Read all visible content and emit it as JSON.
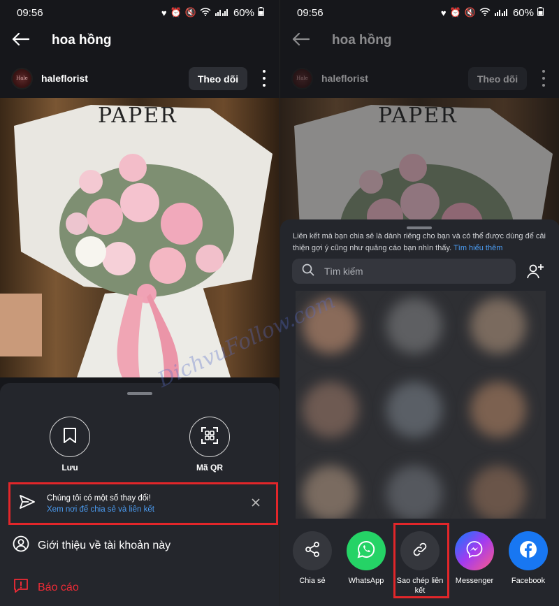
{
  "status": {
    "time": "09:56",
    "battery": "60%"
  },
  "header": {
    "title": "hoa hồng"
  },
  "account": {
    "name": "haleflorist",
    "follow_label": "Theo dõi",
    "avatar_text": "Hale"
  },
  "photo": {
    "brand_text": "PAPER"
  },
  "left_sheet": {
    "save_label": "Lưu",
    "qr_label": "Mã QR",
    "notice_title": "Chúng tôi có một số thay đổi!",
    "notice_link": "Xem nơi để chia sẻ và liên kết",
    "about_label": "Giới thiệu về tài khoản này",
    "report_label": "Báo cáo"
  },
  "right_sheet": {
    "info_text": "Liên kết mà bạn chia sẻ là dành riêng cho bạn và có thể được dùng để cải thiện gợi ý cũng như quảng cáo bạn nhìn thấy.",
    "info_link": "Tìm hiểu thêm",
    "search_placeholder": "Tìm kiếm",
    "share_options": [
      {
        "label": "Chia sẻ",
        "icon": "share-icon",
        "color": "#35373d"
      },
      {
        "label": "WhatsApp",
        "icon": "whatsapp-icon",
        "color": "#25d366"
      },
      {
        "label": "Sao chép liên kết",
        "icon": "link-icon",
        "color": "#35373d"
      },
      {
        "label": "Messenger",
        "icon": "messenger-icon",
        "color": "#a33af0"
      },
      {
        "label": "Facebook",
        "icon": "facebook-icon",
        "color": "#1877f2"
      }
    ]
  },
  "watermark": "DichvuFollow.com",
  "colors": {
    "highlight": "#e2262a",
    "link": "#4b9cf2",
    "report": "#ef2b36"
  }
}
